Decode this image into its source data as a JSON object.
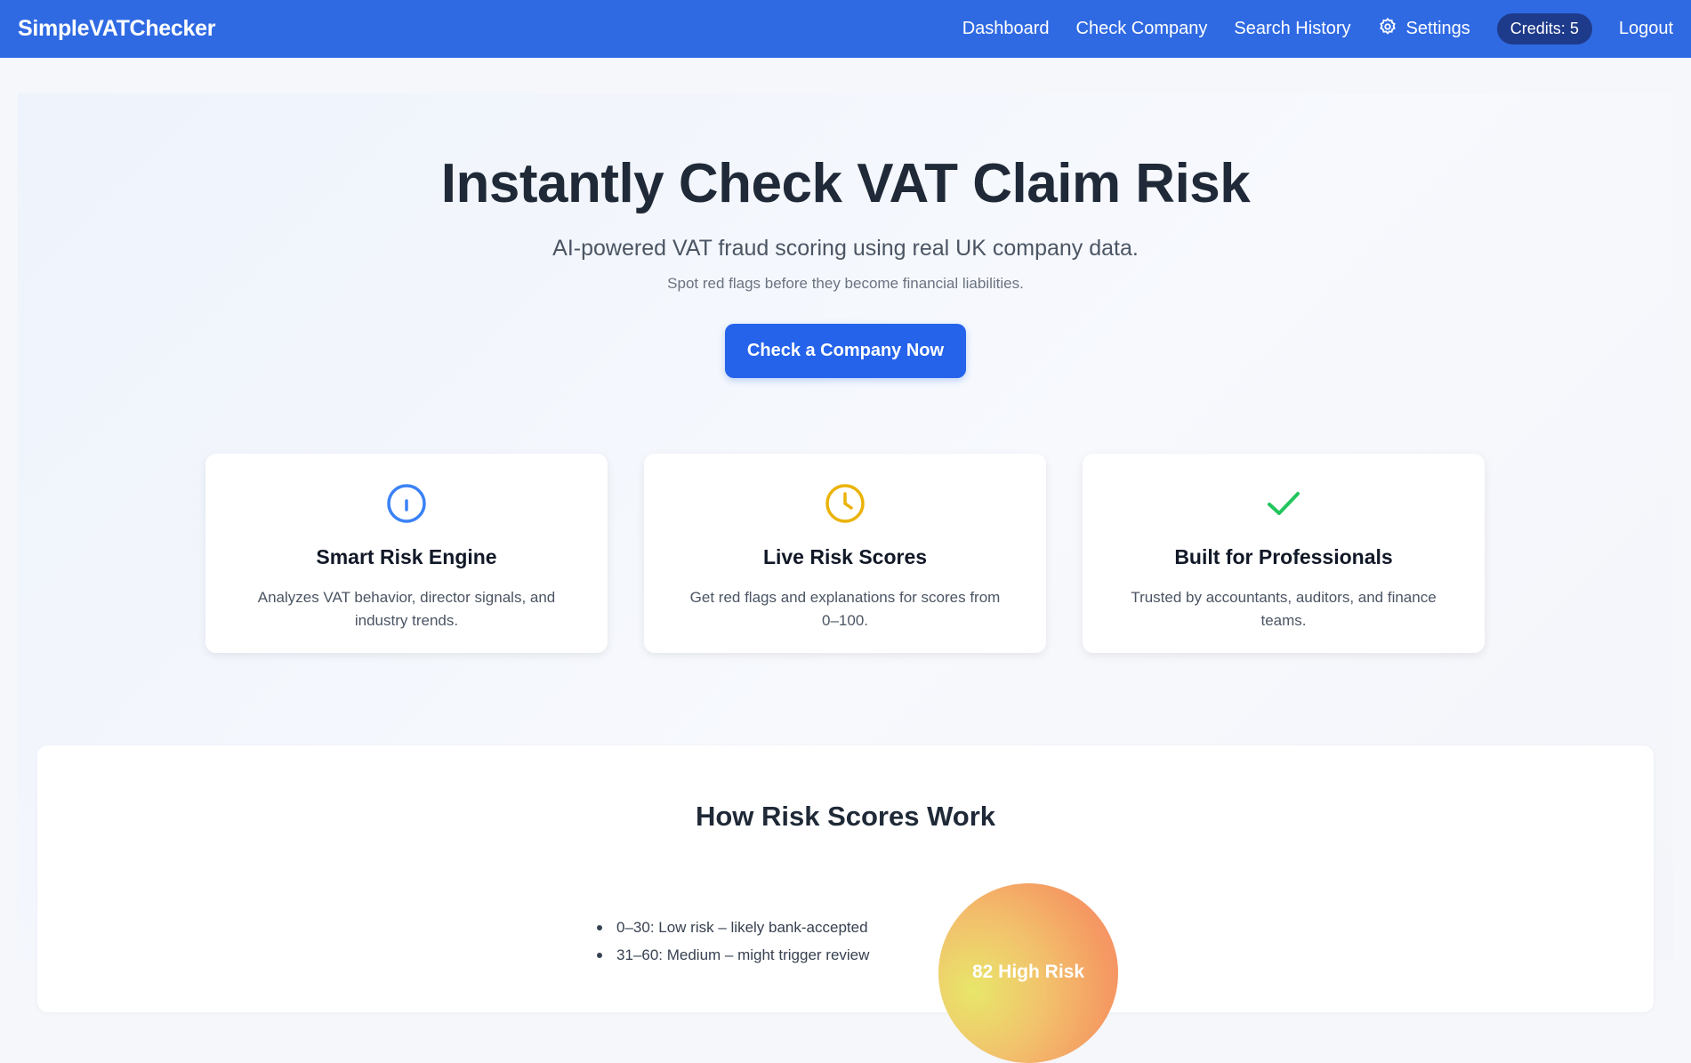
{
  "navbar": {
    "brand": "SimpleVATChecker",
    "links": [
      "Dashboard",
      "Check Company",
      "Search History"
    ],
    "settings_label": "Settings",
    "credits": "Credits: 5",
    "logout": "Logout",
    "background": "#2f6ae3"
  },
  "hero": {
    "title": "Instantly Check VAT Claim Risk",
    "subtitle": "AI-powered VAT fraud scoring using real UK company data.",
    "tagline": "Spot red flags before they become financial liabilities.",
    "cta_label": "Check a Company Now",
    "accent": "#2563eb"
  },
  "features": [
    {
      "icon": "info-icon",
      "icon_color": "#3b82f6",
      "title": "Smart Risk Engine",
      "description": "Analyzes VAT behavior, director signals, and industry trends."
    },
    {
      "icon": "clock-icon",
      "icon_color": "#eab308",
      "title": "Live Risk Scores",
      "description": "Get red flags and explanations for scores from 0–100."
    },
    {
      "icon": "checkmark-icon",
      "icon_color": "#22c55e",
      "title": "Built for Professionals",
      "description": "Trusted by accountants, auditors, and finance teams."
    }
  ],
  "risk_scores": {
    "title": "How Risk Scores Work",
    "items": [
      "0–30: Low risk – likely bank-accepted",
      "31–60: Medium – might trigger review"
    ],
    "gauge_label": "82 High Risk"
  }
}
